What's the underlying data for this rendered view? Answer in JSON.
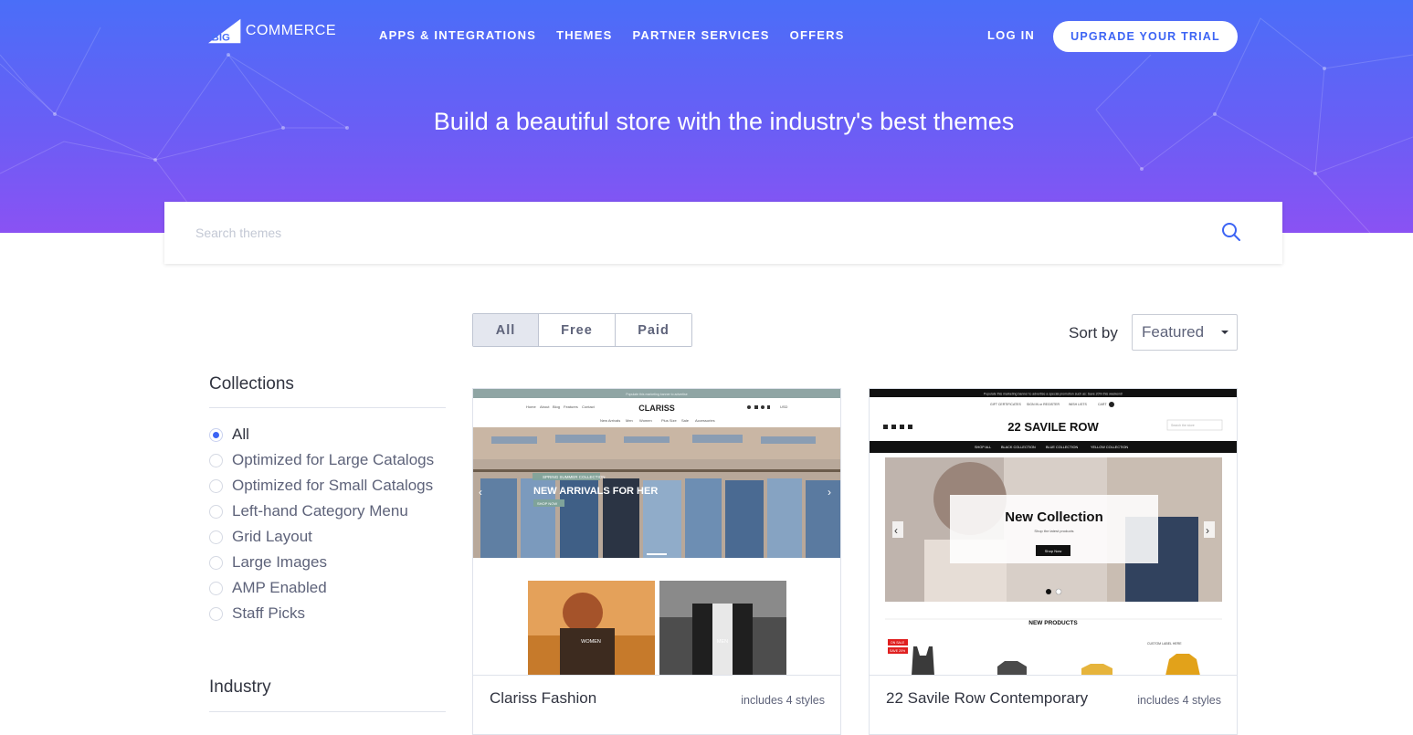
{
  "brand": {
    "logo_big": "BIG",
    "logo_commerce": "COMMERCE"
  },
  "nav": {
    "items": [
      "APPS & INTEGRATIONS",
      "THEMES",
      "PARTNER SERVICES",
      "OFFERS"
    ],
    "login": "LOG IN",
    "upgrade": "UPGRADE YOUR TRIAL"
  },
  "hero": {
    "title": "Build a beautiful store with the industry's best themes"
  },
  "search": {
    "placeholder": "Search themes"
  },
  "filters": {
    "all": "All",
    "free": "Free",
    "paid": "Paid",
    "selected": "All"
  },
  "sort": {
    "label": "Sort by",
    "selected": "Featured"
  },
  "sidebar": {
    "collections_heading": "Collections",
    "collections": [
      "All",
      "Optimized for Large Catalogs",
      "Optimized for Small Catalogs",
      "Left-hand Category Menu",
      "Grid Layout",
      "Large Images",
      "AMP Enabled",
      "Staff Picks"
    ],
    "selected_collection": "All",
    "industry_heading": "Industry"
  },
  "themes": [
    {
      "name": "Clariss Fashion",
      "styles": "includes 4 styles",
      "preview": {
        "banner": "Populate this marketing banner to advertise",
        "store_name": "CLARISS",
        "top_links": [
          "Home",
          "About",
          "Blog",
          "Features",
          "Contact"
        ],
        "currency": "USD",
        "menu": [
          "New Arrivals",
          "Men",
          "Women",
          "Plus Size",
          "Sale",
          "Accessories"
        ],
        "slide_tag": "SPRING SUMMER COLLECTION",
        "slide_title": "NEW ARRIVALS FOR HER",
        "slide_button": "SHOP NOW",
        "tiles": [
          "WOMEN",
          "MEN"
        ]
      }
    },
    {
      "name": "22 Savile Row Contemporary",
      "styles": "includes 4 styles",
      "preview": {
        "banner": "Populate this marketing banner to advertise a special promotion such as: Save 20% this weekend!",
        "utility_links": [
          "GIFT CERTIFICATES",
          "SIGN IN or REGISTER",
          "WISH LISTS",
          "CART"
        ],
        "store_name": "22 SAVILE ROW",
        "search_placeholder": "Search the store",
        "menu": [
          "SHOP ALL",
          "BLACK COLLECTION",
          "BLUE COLLECTION",
          "YELLOW COLLECTION"
        ],
        "slide_title": "New Collection",
        "slide_subtitle": "Shop the latest products",
        "slide_button": "Shop Now",
        "section_title": "NEW PRODUCTS",
        "badges": [
          "ON SALE",
          "SAVE 20%"
        ],
        "custom_label": "CUSTOM LABEL HERE"
      }
    }
  ],
  "colors": {
    "accent": "#3c64f4",
    "hero_top": "#4a6ef8",
    "hero_bottom": "#8a52f3"
  }
}
